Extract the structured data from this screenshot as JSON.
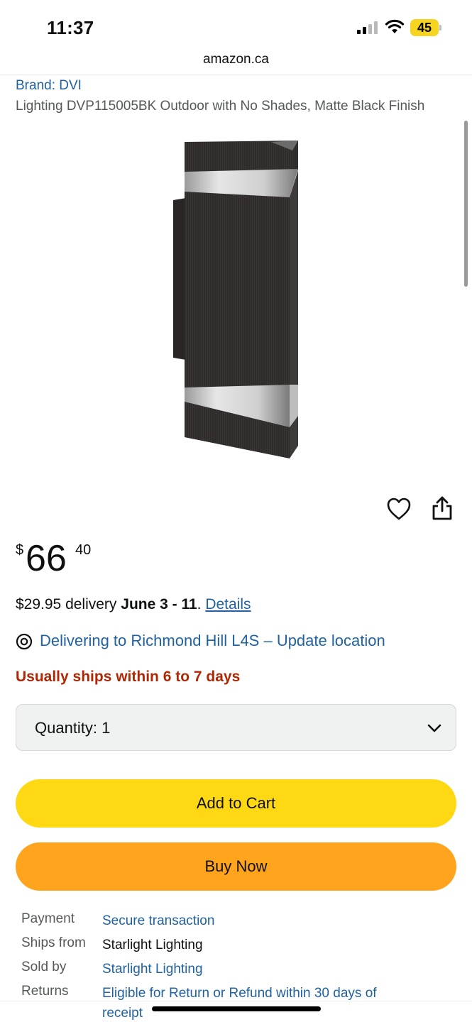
{
  "status_bar": {
    "time": "11:37",
    "battery": "45"
  },
  "browser": {
    "url": "amazon.ca"
  },
  "product": {
    "brand": "Brand: DVI",
    "title": "Lighting DVP115005BK Outdoor with No Shades, Matte Black Finish"
  },
  "price": {
    "symbol": "$",
    "whole": "66",
    "fraction": "40"
  },
  "delivery": {
    "prefix": "$29.95 delivery ",
    "dates": "June 3 - 11",
    "suffix": ". ",
    "details_link": "Details"
  },
  "location": {
    "text": "Delivering to Richmond Hill L4S – Update location"
  },
  "availability": "Usually ships within 6 to 7 days",
  "quantity": {
    "label": "Quantity:",
    "value": "1"
  },
  "buttons": {
    "add_to_cart": "Add to Cart",
    "buy_now": "Buy Now"
  },
  "details": [
    {
      "label": "Payment",
      "value": "Secure transaction"
    },
    {
      "label": "Ships from",
      "value": "Starlight Lighting"
    },
    {
      "label": "Sold by",
      "value": "Starlight Lighting"
    },
    {
      "label": "Returns",
      "value": "Eligible for Return or Refund within 30 days of receipt"
    }
  ],
  "icons": {
    "wishlist": "heart-icon",
    "share": "share-icon",
    "location": "location-pin-icon",
    "dropdown": "chevron-down-icon"
  },
  "colors": {
    "link": "#2162a1",
    "availability": "#b12704",
    "add_to_cart_bg": "#ffd814",
    "buy_now_bg": "#ffa41c"
  }
}
